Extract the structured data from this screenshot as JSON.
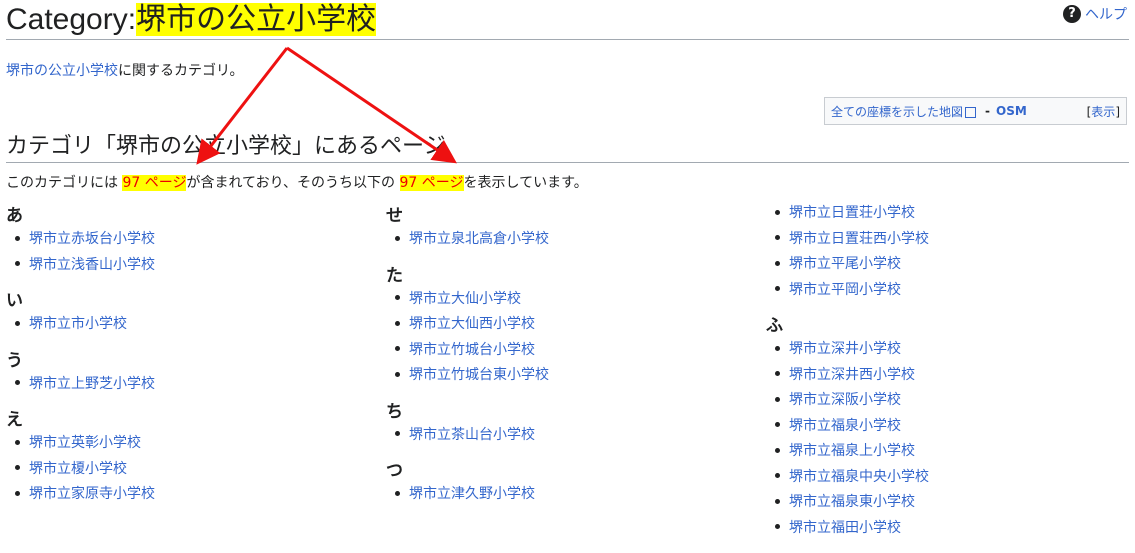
{
  "header": {
    "title_prefix": "Category:",
    "title_name": "堺市の公立小学校",
    "help_label": "ヘルプ",
    "help_icon": "question-circle-icon"
  },
  "description": {
    "link": "堺市の公立小学校",
    "text": "に関するカテゴリ。"
  },
  "coordinates_box": {
    "map_link": "全ての座標を示した地図",
    "separator": "-",
    "osm_link": "OSM",
    "toggle_open": "[",
    "toggle_label": "表示",
    "toggle_close": "]",
    "ext_icon": "external-link-icon"
  },
  "section": {
    "heading": "カテゴリ「堺市の公立小学校」にあるページ",
    "count_pre": "このカテゴリには ",
    "count_total": "97 ページ",
    "count_mid": "が含まれており、そのうち以下の ",
    "count_shown": "97 ページ",
    "count_post": "を表示しています。"
  },
  "columns": [
    {
      "groups": [
        {
          "letter": "あ",
          "items": [
            "堺市立赤坂台小学校",
            "堺市立浅香山小学校"
          ]
        },
        {
          "letter": "い",
          "items": [
            "堺市立市小学校"
          ]
        },
        {
          "letter": "う",
          "items": [
            "堺市立上野芝小学校"
          ]
        },
        {
          "letter": "え",
          "items": [
            "堺市立英彰小学校",
            "堺市立榎小学校",
            "堺市立家原寺小学校"
          ]
        }
      ]
    },
    {
      "groups": [
        {
          "letter": "せ",
          "items": [
            "堺市立泉北高倉小学校"
          ]
        },
        {
          "letter": "た",
          "items": [
            "堺市立大仙小学校",
            "堺市立大仙西小学校",
            "堺市立竹城台小学校",
            "堺市立竹城台東小学校"
          ]
        },
        {
          "letter": "ち",
          "items": [
            "堺市立茶山台小学校"
          ]
        },
        {
          "letter": "つ",
          "items": [
            "堺市立津久野小学校"
          ]
        }
      ]
    },
    {
      "groups": [
        {
          "letter": "",
          "items": [
            "堺市立日置荘小学校",
            "堺市立日置荘西小学校",
            "堺市立平尾小学校",
            "堺市立平岡小学校"
          ]
        },
        {
          "letter": "ふ",
          "items": [
            "堺市立深井小学校",
            "堺市立深井西小学校",
            "堺市立深阪小学校",
            "堺市立福泉小学校",
            "堺市立福泉上小学校",
            "堺市立福泉中央小学校",
            "堺市立福泉東小学校",
            "堺市立福田小学校"
          ]
        }
      ]
    }
  ],
  "colors": {
    "link": "#3366cc",
    "highlight": "#ffff00",
    "arrow": "#ee1111"
  }
}
